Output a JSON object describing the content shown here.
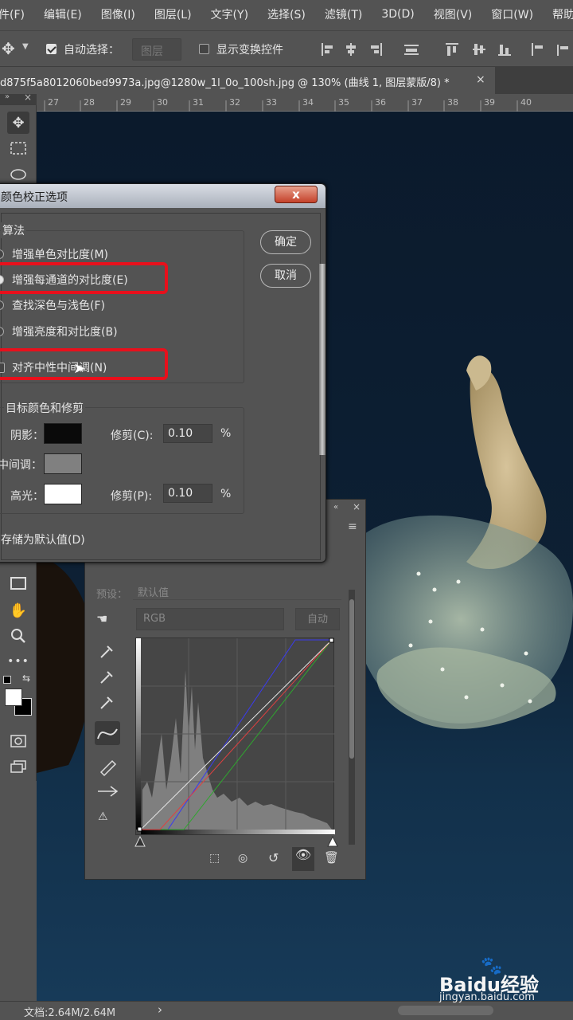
{
  "menu": [
    "件(F)",
    "编辑(E)",
    "图像(I)",
    "图层(L)",
    "文字(Y)",
    "选择(S)",
    "滤镜(T)",
    "3D(D)",
    "视图(V)",
    "窗口(W)",
    "帮助(H)"
  ],
  "options": {
    "auto_select_label": "自动选择：",
    "auto_select_value": "图层",
    "show_transform_label": "显示变换控件"
  },
  "document_tab": "d875f5a8012060bed9973a.jpg@1280w_1l_0o_100sh.jpg @ 130% (曲线 1, 图层蒙版/8) *",
  "ruler_ticks": [
    "27",
    "28",
    "29",
    "30",
    "31",
    "32",
    "33",
    "34",
    "35",
    "36",
    "37",
    "38",
    "39",
    "40"
  ],
  "dialog": {
    "title": "颜色校正选项",
    "close_label": "x",
    "ok_label": "确定",
    "cancel_label": "取消",
    "algorithm_label": "算法",
    "algorithms": [
      "增强单色对比度(M)",
      "增强每通道的对比度(E)",
      "查找深色与浅色(F)",
      "增强亮度和对比度(B)"
    ],
    "snap_neutral_label": "对齐中性中间调(N)",
    "target_label": "目标颜色和修剪",
    "shadows_label": "阴影：",
    "midtones_label": "中间调：",
    "highlights_label": "高光：",
    "clip_c_label": "修剪(C):",
    "clip_c_value": "0.10",
    "clip_p_label": "修剪(P):",
    "clip_p_value": "0.10",
    "percent": "%",
    "save_default_label": "存储为默认值(D)",
    "shadow_color": "#0a0a0a",
    "midtone_color": "#808080",
    "highlight_color": "#ffffff"
  },
  "properties": {
    "preset_label": "预设：",
    "preset_value": "默认值",
    "channel_value": "RGB",
    "auto_label": "自动"
  },
  "status": {
    "doc_info": "文档:2.64M/2.64M",
    "arrow": "›"
  },
  "watermark": {
    "brand": "Baidu经验",
    "url": "jingyan.baidu.com"
  },
  "colors": {
    "highlight_box": "#e8101c",
    "panel_bg": "#535353"
  }
}
